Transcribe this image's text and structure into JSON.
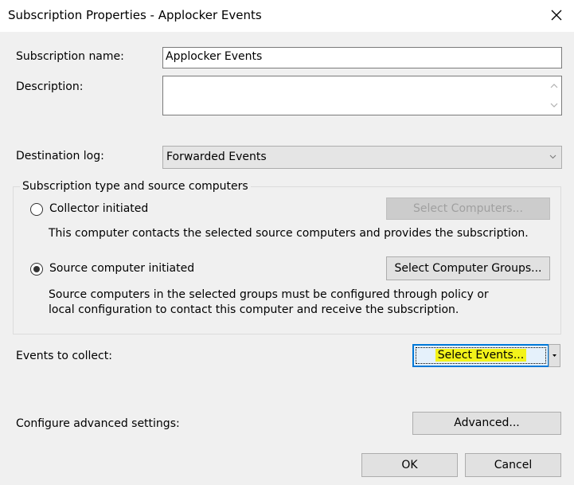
{
  "window": {
    "title": "Subscription Properties - Applocker Events"
  },
  "form": {
    "subscription_name_label": "Subscription name:",
    "subscription_name_value": "Applocker Events",
    "description_label": "Description:",
    "description_value": "",
    "destination_log_label": "Destination log:",
    "destination_log_value": "Forwarded Events"
  },
  "group": {
    "title": "Subscription type and source computers",
    "collector": {
      "label": "Collector initiated",
      "selected": false,
      "desc": "This computer contacts the selected source computers and provides the subscription.",
      "button": "Select Computers..."
    },
    "source": {
      "label": "Source computer initiated",
      "selected": true,
      "desc_line1": "Source computers in the selected groups must be configured through policy or",
      "desc_line2": "local configuration to contact this computer and receive the subscription.",
      "button": "Select Computer Groups..."
    }
  },
  "events": {
    "label": "Events to collect:",
    "button": "Select Events..."
  },
  "advanced": {
    "label": "Configure advanced settings:",
    "button": "Advanced..."
  },
  "footer": {
    "ok": "OK",
    "cancel": "Cancel"
  },
  "colors": {
    "focus": "#0078d7",
    "highlight": "#f3f31a"
  },
  "icons": {
    "close": "close-icon",
    "dropdown": "chevron-down-icon",
    "scroll_up": "chevron-up-icon",
    "scroll_down": "chevron-down-icon"
  }
}
